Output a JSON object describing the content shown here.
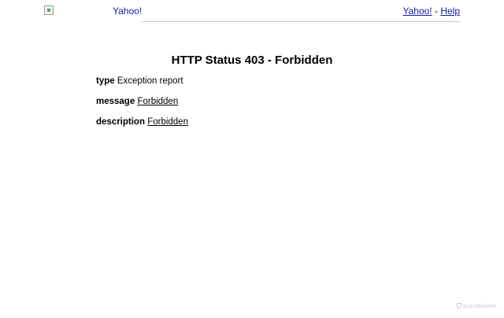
{
  "header": {
    "logo_alt": "Yahoo!",
    "links": {
      "yahoo": "Yahoo!",
      "separator": " - ",
      "help": "Help"
    }
  },
  "error": {
    "title": "HTTP Status 403 - Forbidden",
    "type_label": "type",
    "type_value": "Exception report",
    "message_label": "message",
    "message_value": "Forbidden",
    "description_label": "description",
    "description_value": "Forbidden"
  },
  "watermark": {
    "text": "ScanMalware",
    "icon": "shield-icon"
  }
}
